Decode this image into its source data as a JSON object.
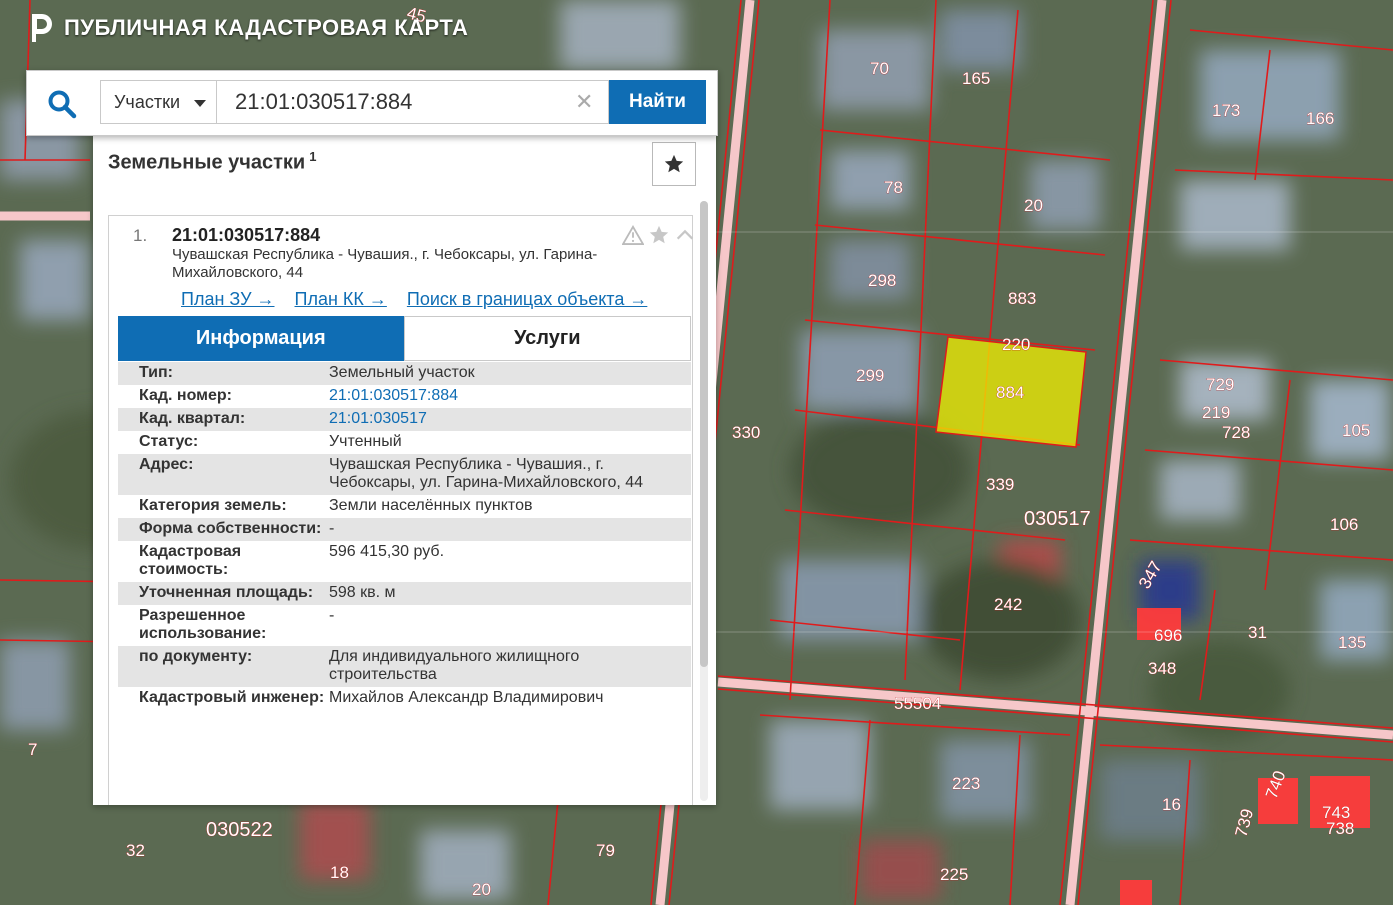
{
  "app": {
    "title": "ПУБЛИЧНАЯ КАДАСТРОВАЯ КАРТА"
  },
  "search": {
    "type_label": "Участки",
    "value": "21:01:030517:884",
    "clear_glyph": "✕",
    "button_label": "Найти"
  },
  "results": {
    "title": "Земельные участки",
    "count": "1",
    "item": {
      "index": "1.",
      "cad_number": "21:01:030517:884",
      "address": "Чувашская Республика - Чувашия., г. Чебоксары, ул. Гарина-Михайловского, 44",
      "links": [
        {
          "label": "План ЗУ →"
        },
        {
          "label": "План КК →"
        },
        {
          "label": "Поиск в границах объекта →"
        }
      ],
      "tabs": [
        {
          "label": "Информация"
        },
        {
          "label": "Услуги"
        }
      ],
      "info": [
        {
          "key": "Тип:",
          "value": "Земельный участок"
        },
        {
          "key": "Кад. номер:",
          "value": "21:01:030517:884"
        },
        {
          "key": "Кад. квартал:",
          "value": "21:01:030517"
        },
        {
          "key": "Статус:",
          "value": "Учтенный"
        },
        {
          "key": "Адрес:",
          "value": "Чувашская Республика - Чувашия., г. Чебоксары, ул. Гарина-Михайловского, 44"
        },
        {
          "key": "Категория земель:",
          "value": "Земли населённых пунктов"
        },
        {
          "key": "Форма собственности:",
          "value": "-"
        },
        {
          "key": "Кадастровая стоимость:",
          "value": "596 415,30 руб."
        },
        {
          "key": "Уточненная площадь:",
          "value": "598 кв. м"
        },
        {
          "key": "Разрешенное использование:",
          "value": "-"
        },
        {
          "key": "по документу:",
          "value": "Для индивидуального жилищного строительства"
        },
        {
          "key": "Кадастровый инженер:",
          "value": "Михайлов Александр Владимирович"
        }
      ]
    }
  },
  "map": {
    "colors": {
      "boundary": "#e01b1b",
      "selected_fill": "#f2f200",
      "road": "#f6c7c9",
      "label_text": "#ffffff"
    },
    "parcel_labels": [
      "45",
      "70",
      "165",
      "173",
      "166",
      "78",
      "20",
      "298",
      "883",
      "220",
      "299",
      "884",
      "729",
      "219",
      "728",
      "105",
      "330",
      "339",
      "030517",
      "106",
      "347",
      "696",
      "31",
      "135",
      "348",
      "242",
      "55504",
      "7",
      "223",
      "16",
      "740",
      "743",
      "738",
      "739",
      "030522",
      "32",
      "79",
      "18",
      "225",
      "20"
    ]
  },
  "colors": {
    "accent": "#0f6db4"
  }
}
